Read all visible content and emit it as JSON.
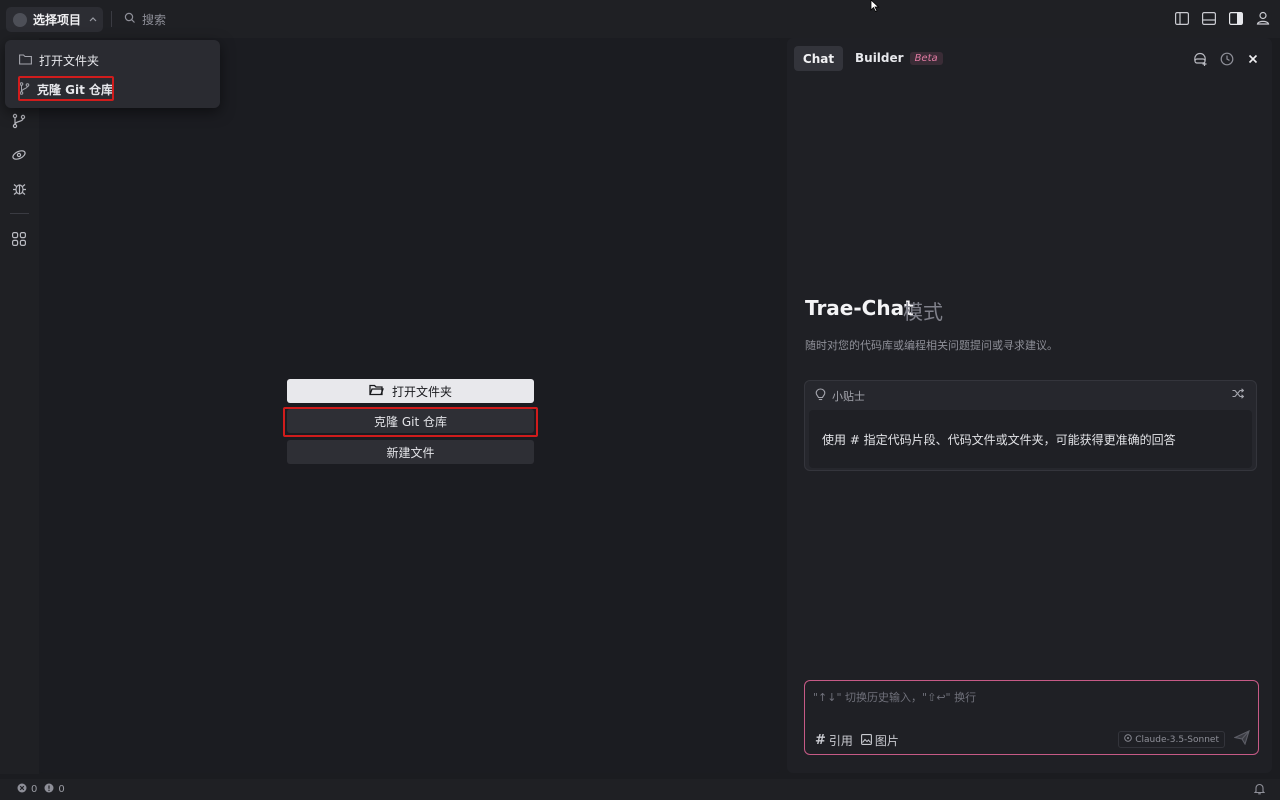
{
  "titlebar": {
    "project_label": "选择项目",
    "search_placeholder": "搜索",
    "right_icons": [
      "toggle-left-sidebar-icon",
      "toggle-panel-icon",
      "toggle-right-sidebar-icon",
      "account-icon"
    ]
  },
  "activity_bar": {
    "icons": [
      "source-control-icon",
      "remote-icon",
      "debug-icon",
      "extensions-icon"
    ]
  },
  "project_menu": {
    "items": [
      {
        "label": "打开文件夹",
        "icon": "folder-icon"
      },
      {
        "label": "克隆 Git 仓库",
        "icon": "git-branch-icon"
      }
    ]
  },
  "welcome": {
    "open_folder": "打开文件夹",
    "clone_repo": "克隆 Git 仓库",
    "new_file": "新建文件"
  },
  "chat": {
    "tab_chat": "Chat",
    "tab_builder": "Builder",
    "beta_badge": "Beta",
    "mode_title": "Trae-Chat",
    "mode_suffix": "模式",
    "mode_desc": "随时对您的代码库或编程相关问题提问或寻求建议。",
    "tip_title": "小贴士",
    "tip_text": "使用 # 指定代码片段、代码文件或文件夹，可能获得更准确的回答",
    "input_placeholder": "\"↑↓\" 切换历史输入，\"⇧↩\" 换行",
    "tool_ref": "引用",
    "tool_image": "图片",
    "model": "Claude-3.5-Sonnet"
  },
  "statusbar": {
    "errors": "0",
    "warnings": "0"
  },
  "colors": {
    "highlight": "#d01c1c",
    "accent_pink": "#c65a86"
  }
}
